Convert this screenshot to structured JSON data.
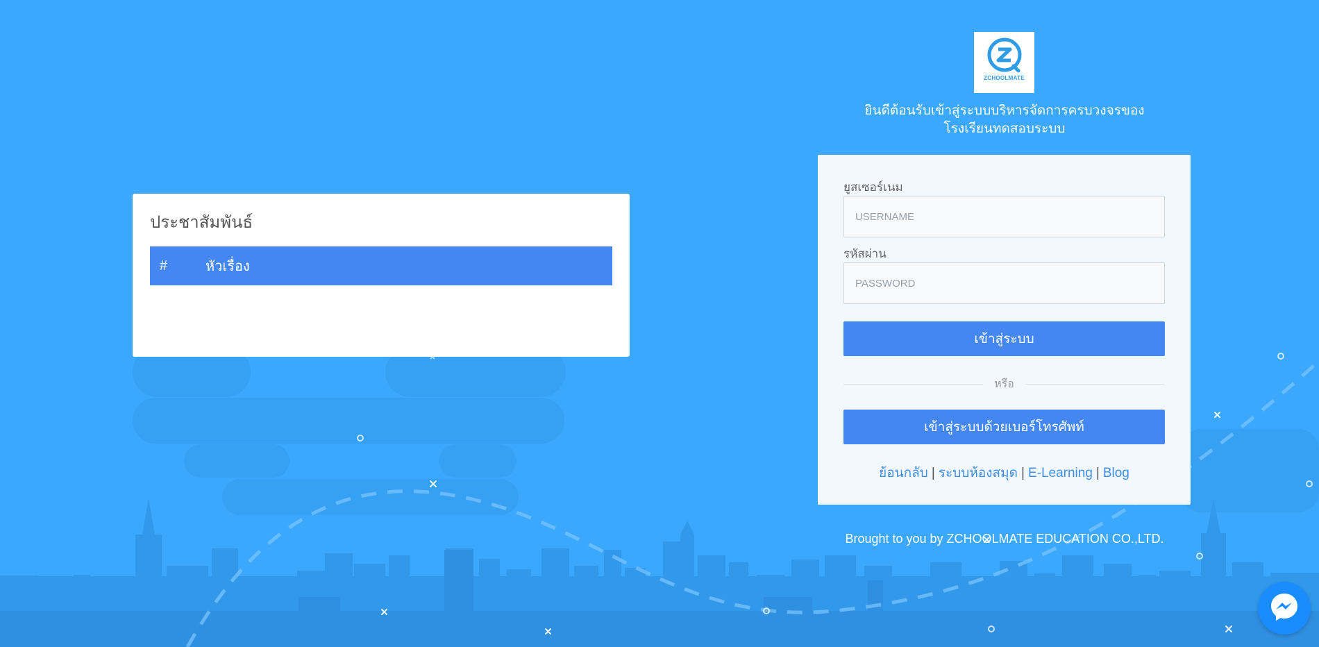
{
  "announcements": {
    "title": "ประชาสัมพันธ์",
    "columns": [
      "#",
      "หัวเรื่อง"
    ]
  },
  "logo": {
    "text": "ZCHOOLMATE"
  },
  "welcome": {
    "line1": "ยินดีต้อนรับเข้าสู่ระบบบริหารจัดการครบวงจรของ",
    "line2": "โรงเรียนทดสอบระบบ"
  },
  "login": {
    "username_label": "ยูสเซอร์เนม",
    "username_placeholder": "USERNAME",
    "password_label": "รหัสผ่าน",
    "password_placeholder": "PASSWORD",
    "login_button": "เข้าสู่ระบบ",
    "or_text": "หรือ",
    "phone_login_button": "เข้าสู่ระบบด้วยเบอร์โทรศัพท์"
  },
  "links": [
    {
      "label": "ย้อนกลับ"
    },
    {
      "label": "ระบบห้องสมุด"
    },
    {
      "label": "E-Learning"
    },
    {
      "label": "Blog"
    }
  ],
  "footer": {
    "credit": "Brought to you by ZCHOOLMATE EDUCATION CO.,LTD."
  },
  "colors": {
    "background": "#3ba8fd",
    "primary_button": "#4487f2",
    "link": "#3f8ee8",
    "card": "#f3f8fe"
  },
  "icons": {
    "logo": "zchoolmate-logo-icon",
    "messenger": "messenger-icon"
  }
}
